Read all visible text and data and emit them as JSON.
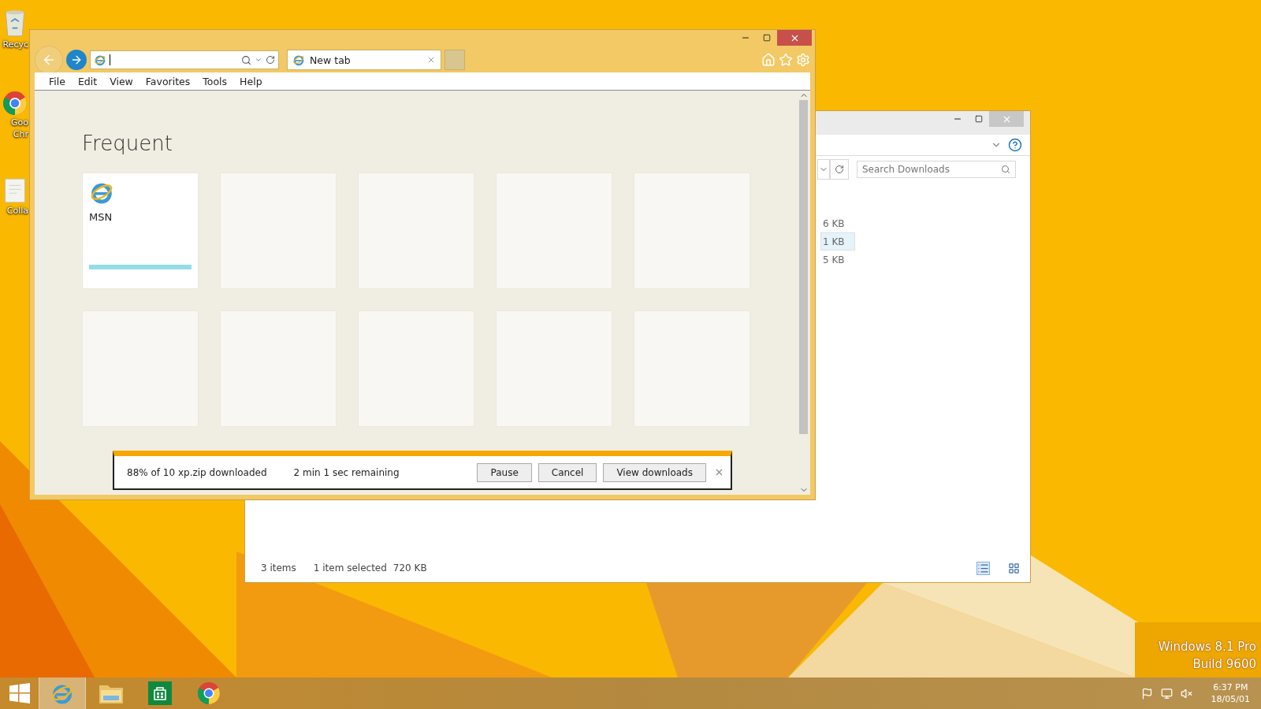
{
  "desktop_icons": [
    {
      "kind": "recycle-bin",
      "lines": [
        "Recyc"
      ]
    },
    {
      "kind": "chrome",
      "lines": [
        "Goo",
        "Chr"
      ]
    },
    {
      "kind": "document",
      "lines": [
        "Colla"
      ]
    }
  ],
  "explorer": {
    "search": {
      "placeholder": "Search Downloads"
    },
    "files": [
      {
        "size": "6 KB",
        "selected": false
      },
      {
        "size": "1 KB",
        "selected": true
      },
      {
        "size": "5 KB",
        "selected": false
      }
    ],
    "status": {
      "count": "3 items",
      "selection": "1 item selected",
      "size": "720 KB"
    }
  },
  "browser": {
    "tabs": [
      {
        "label": "New tab",
        "selected": true
      }
    ],
    "menu": [
      "File",
      "Edit",
      "View",
      "Favorites",
      "Tools",
      "Help"
    ],
    "heading": "Frequent",
    "tiles": [
      {
        "kind": "site",
        "label": "MSN"
      },
      {
        "kind": "empty"
      },
      {
        "kind": "empty"
      },
      {
        "kind": "empty"
      },
      {
        "kind": "empty"
      },
      {
        "kind": "empty"
      },
      {
        "kind": "empty"
      },
      {
        "kind": "empty"
      },
      {
        "kind": "empty"
      },
      {
        "kind": "empty"
      }
    ],
    "download_bar": {
      "status": "88% of 10 xp.zip downloaded",
      "remaining": "2 min 1 sec remaining",
      "buttons": [
        "Pause",
        "Cancel",
        "View downloads"
      ]
    }
  },
  "edition": {
    "name": "Windows 8.1 Pro",
    "build": "Build 9600"
  },
  "taskbar": {
    "apps": [
      {
        "kind": "ie",
        "selected": true
      },
      {
        "kind": "explorer",
        "selected": false
      },
      {
        "kind": "store",
        "selected": false
      },
      {
        "kind": "chrome",
        "selected": false
      }
    ],
    "clock": {
      "time": "6:37 PM",
      "date": "18/05/01"
    }
  }
}
